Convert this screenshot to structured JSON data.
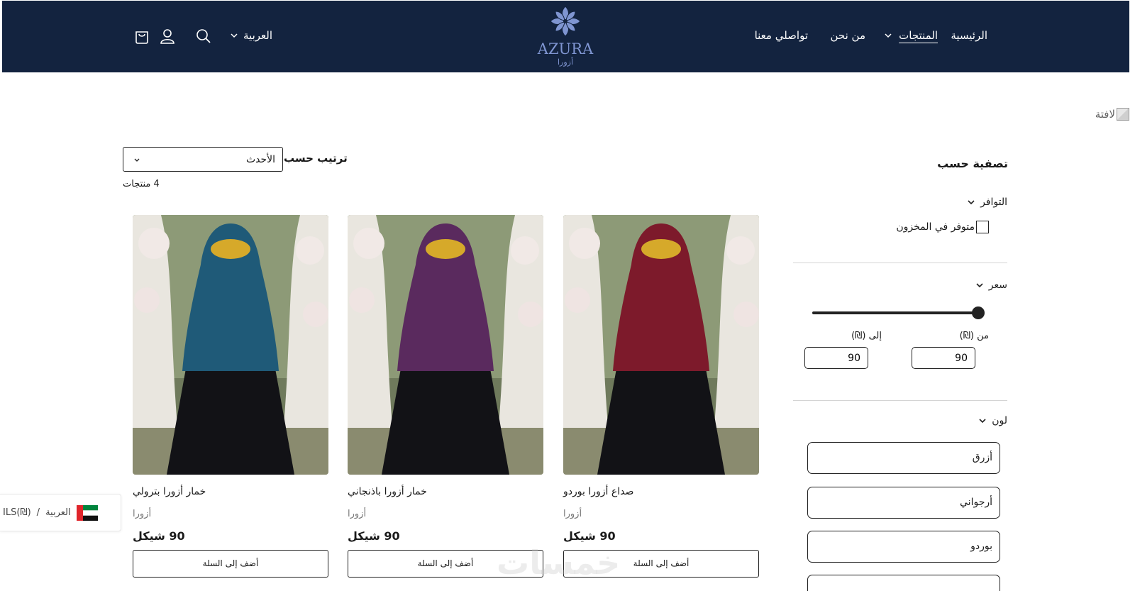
{
  "header": {
    "nav": {
      "home": "الرئيسية",
      "products": "المنتجات",
      "about": "من نحن",
      "contact": "تواصلي معنا"
    },
    "logo": {
      "word": "AZURA",
      "sub": "أزورا"
    },
    "language": "العربية",
    "icons": [
      "search-icon",
      "account-icon",
      "cart-icon"
    ]
  },
  "banner": {
    "alt_text": "لافتة"
  },
  "filters": {
    "title": "تصفية حسب",
    "availability": {
      "label": "التوافر",
      "in_stock": "متوفر في المخزون"
    },
    "price": {
      "label": "سعر",
      "from_label": "من (₪)",
      "to_label": "إلى (₪)",
      "from_value": "90",
      "to_value": "90"
    },
    "color": {
      "label": "لون",
      "options": [
        "أزرق",
        "أرجواني",
        "بوردو",
        "..."
      ]
    }
  },
  "sort": {
    "label": "ترتيب حسب",
    "value": "الأحدث"
  },
  "count": "4 منتجات",
  "products": [
    {
      "title": "صداع أزورا بوردو",
      "vendor": "أزورا",
      "price": "90 شيكل",
      "add_to_cart": "أضف إلى السلة",
      "color": "#7d1a2b"
    },
    {
      "title": "خمار أزورا باذنجاني",
      "vendor": "أزورا",
      "price": "90 شيكل",
      "add_to_cart": "أضف إلى السلة",
      "color": "#5a2a5e"
    },
    {
      "title": "خمار أزورا بترولي",
      "vendor": "أزورا",
      "price": "90 شيكل",
      "add_to_cart": "أضف إلى السلة",
      "color": "#1f5a78"
    }
  ],
  "locale": {
    "language": "العربية",
    "currency": "ILS(₪)"
  },
  "watermark": "خمسات",
  "colors": {
    "header_bg": "#13233f",
    "logo": "#7f95d1"
  }
}
